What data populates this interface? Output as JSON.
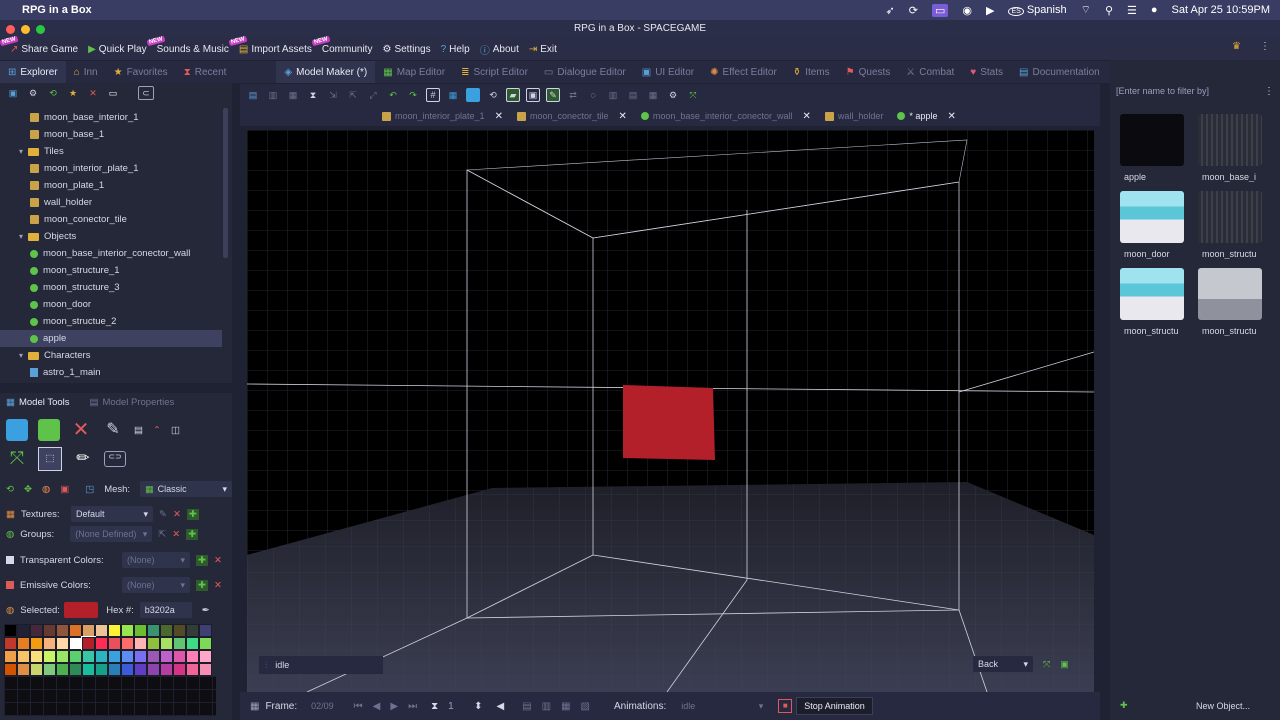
{
  "mac": {
    "app_name": "RPG in a Box",
    "input_method": "Spanish",
    "clock": "Sat Apr 25  10:59PM"
  },
  "window": {
    "title": "RPG in a Box - SPACEGAME"
  },
  "menu": [
    "Share Game",
    "Quick Play",
    "Sounds & Music",
    "Import Assets",
    "Community",
    "Settings",
    "Help",
    "About",
    "Exit"
  ],
  "new_badge": "NEW",
  "left_tabs": [
    "Explorer",
    "Inn",
    "Favorites",
    "Recent"
  ],
  "editor_tabs": [
    "Model Maker (*)",
    "Map Editor",
    "Script Editor",
    "Dialogue Editor",
    "UI Editor",
    "Effect Editor",
    "Items",
    "Quests",
    "Combat",
    "Stats",
    "Documentation"
  ],
  "tree": {
    "items": [
      {
        "label": "moon_base_interior_1",
        "kind": "tile",
        "indent": 1
      },
      {
        "label": "moon_base_1",
        "kind": "tile",
        "indent": 1
      },
      {
        "label": "Tiles",
        "kind": "folder",
        "indent": 0
      },
      {
        "label": "moon_interior_plate_1",
        "kind": "tile",
        "indent": 1
      },
      {
        "label": "moon_plate_1",
        "kind": "tile",
        "indent": 1
      },
      {
        "label": "wall_holder",
        "kind": "tile",
        "indent": 1
      },
      {
        "label": "moon_conector_tile",
        "kind": "tile",
        "indent": 1
      },
      {
        "label": "Objects",
        "kind": "folder",
        "indent": 0
      },
      {
        "label": "moon_base_interior_conector_wall",
        "kind": "pin",
        "indent": 1
      },
      {
        "label": "moon_structure_1",
        "kind": "pin",
        "indent": 1
      },
      {
        "label": "moon_structure_3",
        "kind": "pin",
        "indent": 1
      },
      {
        "label": "moon_door",
        "kind": "pin",
        "indent": 1
      },
      {
        "label": "moon_structue_2",
        "kind": "pin",
        "indent": 1
      },
      {
        "label": "apple",
        "kind": "pin",
        "indent": 1,
        "selected": true
      },
      {
        "label": "Characters",
        "kind": "folder",
        "indent": 0
      },
      {
        "label": "astro_1_main",
        "kind": "char",
        "indent": 1
      }
    ]
  },
  "tools": {
    "tab_model_tools": "Model Tools",
    "tab_model_properties": "Model Properties",
    "mesh_label": "Mesh:",
    "mesh_value": "Classic",
    "textures_label": "Textures:",
    "textures_value": "Default",
    "groups_label": "Groups:",
    "groups_value": "(None Defined)",
    "transparent_label": "Transparent Colors:",
    "transparent_value": "(None)",
    "emissive_label": "Emissive Colors:",
    "emissive_value": "(None)",
    "selected_label": "Selected:",
    "selected_color": "#b3202a",
    "hex_label": "Hex #:",
    "hex_value": "b3202a"
  },
  "palette": [
    "#000000",
    "#222034",
    "#45283c",
    "#663931",
    "#8f563b",
    "#df7126",
    "#d9a066",
    "#eec39a",
    "#fbf236",
    "#99e550",
    "#6abe30",
    "#37946e",
    "#4b692f",
    "#524b24",
    "#323c39",
    "#3f3f74",
    "#c0392b",
    "#e67e22",
    "#f39c12",
    "#f7b27a",
    "#ffd8a8",
    "#ffffff",
    "#b3202a",
    "#ff2d55",
    "#e8505b",
    "#ff6b6b",
    "#ffb3b3",
    "#8fbf3c",
    "#a8e063",
    "#62c370",
    "#3ddc84",
    "#7ed957",
    "#f0a04b",
    "#f6c36a",
    "#f9e07f",
    "#c7f464",
    "#9be564",
    "#5ad16e",
    "#38c7a6",
    "#2bb3c0",
    "#3aa0e0",
    "#5d8cf5",
    "#7a6ff0",
    "#9b59b6",
    "#c061cb",
    "#e056a8",
    "#ff7eb6",
    "#ffa6c9",
    "#d35400",
    "#e08e45",
    "#c8d66b",
    "#7fc97f",
    "#4caf50",
    "#2e8b57",
    "#1abc9c",
    "#16a085",
    "#2980b9",
    "#3b5bdb",
    "#5f3dc4",
    "#8e44ad",
    "#b43fa0",
    "#d63384",
    "#f06595",
    "#f78fb3"
  ],
  "doc_tabs": [
    {
      "label": "moon_interior_plate_1",
      "icon": "tile"
    },
    {
      "label": "moon_conector_tile",
      "icon": "tile"
    },
    {
      "label": "moon_base_interior_conector_wall",
      "icon": "pin"
    },
    {
      "label": "wall_holder",
      "icon": "tile"
    },
    {
      "label": "* apple",
      "icon": "pin",
      "active": true
    }
  ],
  "viewport": {
    "animation_name": "idle",
    "camera_view": "Back",
    "cube_color": "#b3202a"
  },
  "bottom": {
    "frame_label": "Frame:",
    "frame_value": "02/09",
    "frame_number": "1",
    "animations_label": "Animations:",
    "animations_value": "idle",
    "stop_tooltip": "Stop Animation"
  },
  "right": {
    "filter_placeholder": "[Enter name to filter by]",
    "assets": [
      {
        "label": "apple",
        "style": "black"
      },
      {
        "label": "moon_base_i",
        "style": "stripes"
      },
      {
        "label": "moon_door",
        "style": "door"
      },
      {
        "label": "moon_structu",
        "style": "stripes"
      },
      {
        "label": "moon_structu",
        "style": "door"
      },
      {
        "label": "moon_structu",
        "style": "grey"
      }
    ],
    "new_object": "New Object..."
  }
}
